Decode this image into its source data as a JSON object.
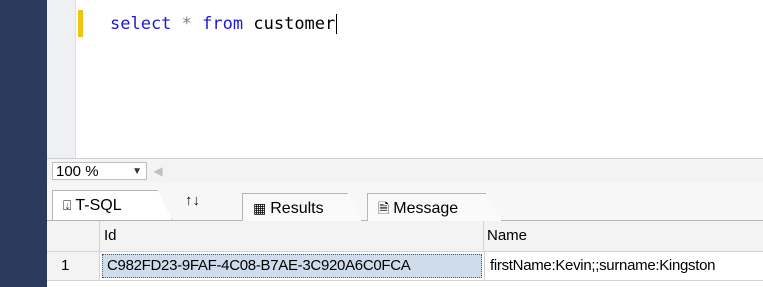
{
  "editor": {
    "query": {
      "keyword_select": "select",
      "operator": "*",
      "keyword_from": "from",
      "table": "customer"
    }
  },
  "zoom": {
    "value": "100 %"
  },
  "tabs": [
    {
      "label": "T-SQL",
      "icon": "tsql-icon"
    },
    {
      "label": "Results",
      "icon": "grid-icon"
    },
    {
      "label": "Message",
      "icon": "message-icon"
    }
  ],
  "grid": {
    "columns": [
      "Id",
      "Name"
    ],
    "rows": [
      {
        "rownum": "1",
        "id": "C982FD23-9FAF-4C08-B7AE-3C920A6C0FCA",
        "name": "firstName:Kevin;;surname:Kingston"
      }
    ]
  },
  "colors": {
    "sidebar": "#2e3a5c",
    "keyword": "#1a1ad8",
    "change_bar": "#f1c40f",
    "selected_cell": "#cfdcec"
  }
}
